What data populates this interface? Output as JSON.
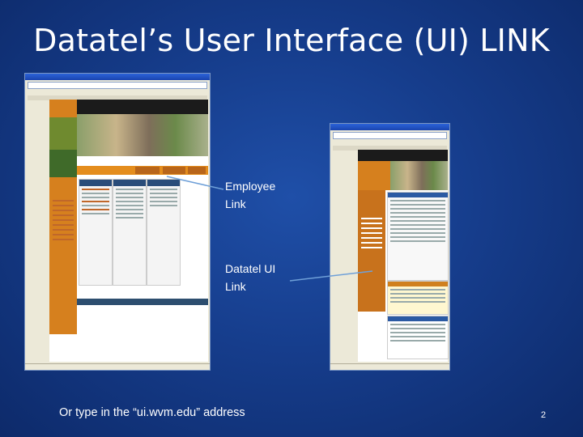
{
  "slide": {
    "title": "Datatel’s User Interface (UI) LINK",
    "employee_label": "Employee Link",
    "datatel_label": "Datatel UI Link",
    "footer": "Or type in the “ui.wvm.edu” address",
    "page_number": "2"
  },
  "colors": {
    "background": "#163d8c",
    "orange": "#d6801e",
    "green": "#3f6a29",
    "arrow": "#6fa0d8"
  },
  "screenshot_left": {
    "nav_items": [
      "",
      "",
      "",
      "",
      ""
    ]
  },
  "screenshot_right": {}
}
